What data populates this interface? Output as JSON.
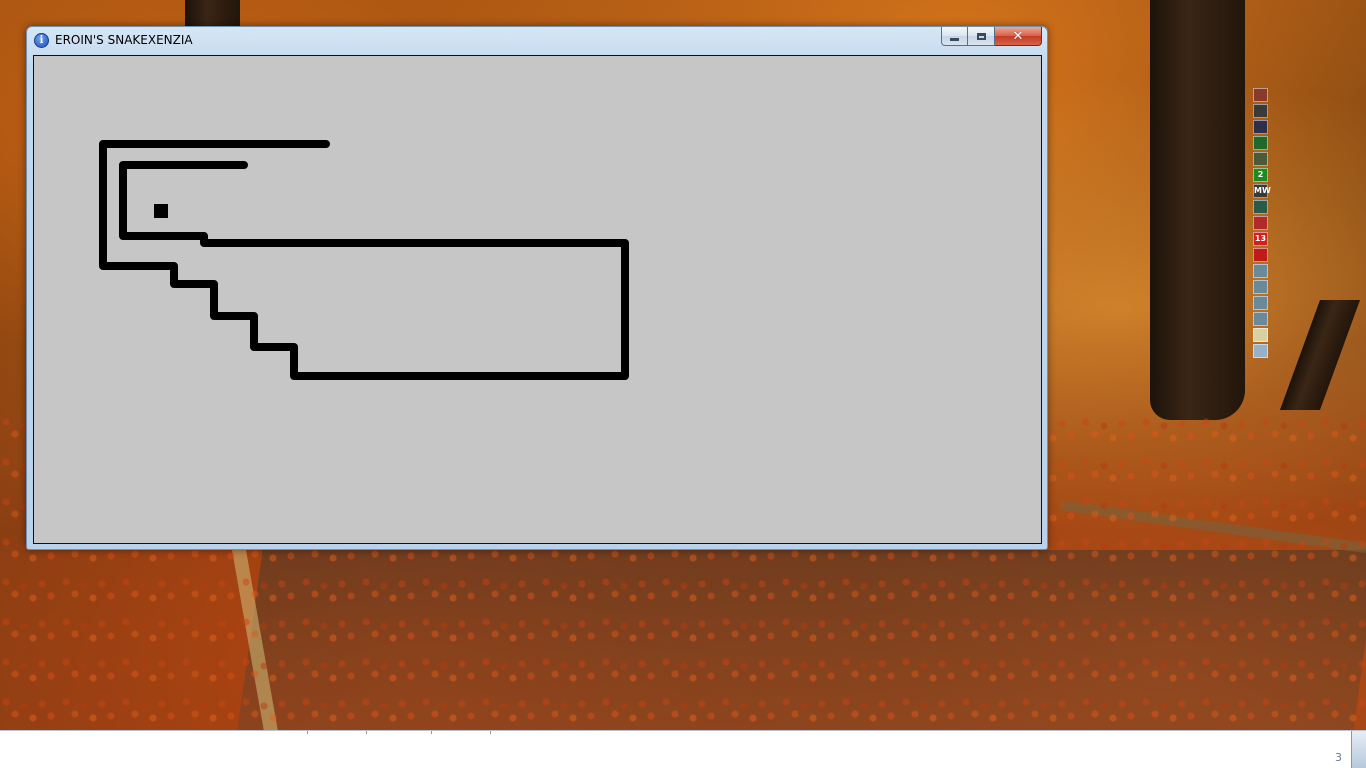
{
  "window": {
    "title": "EROIN'S SNAKEXENZIA",
    "title_icon": "info-icon",
    "controls": {
      "minimize": "minimize-icon",
      "maximize": "maximize-icon",
      "close": "✕"
    }
  },
  "game": {
    "background_color": "#c6c6c6",
    "snake_color": "#000000",
    "food_color": "#000000"
  },
  "desktop": {
    "wallpaper": "autumn-forest-road",
    "strip_icons": [
      {
        "name": "app-icon-1",
        "color": "#8a3a2a",
        "label": ""
      },
      {
        "name": "app-icon-2",
        "color": "#3a3a3a",
        "label": ""
      },
      {
        "name": "app-icon-3",
        "color": "#2f2f4a",
        "label": ""
      },
      {
        "name": "app-icon-4",
        "color": "#1f6a2a",
        "label": ""
      },
      {
        "name": "app-icon-5",
        "color": "#4a5a3a",
        "label": ""
      },
      {
        "name": "app-icon-6",
        "color": "#1f8a1f",
        "label": "2"
      },
      {
        "name": "app-icon-7",
        "color": "#3a3a3a",
        "label": "MW"
      },
      {
        "name": "app-icon-8",
        "color": "#2a5a4a",
        "label": ""
      },
      {
        "name": "app-icon-9",
        "color": "#b02a2a",
        "label": ""
      },
      {
        "name": "app-icon-10",
        "color": "#d02020",
        "label": "13"
      },
      {
        "name": "app-icon-11",
        "color": "#c01a1a",
        "label": ""
      },
      {
        "name": "app-icon-12",
        "color": "#6a8a9a",
        "label": ""
      },
      {
        "name": "app-icon-13",
        "color": "#6a8a9a",
        "label": ""
      },
      {
        "name": "app-icon-14",
        "color": "#6a8a9a",
        "label": ""
      },
      {
        "name": "app-icon-15",
        "color": "#6a8a9a",
        "label": ""
      },
      {
        "name": "app-icon-16",
        "color": "#d8d0a0",
        "label": ""
      },
      {
        "name": "recycle-bin-icon",
        "color": "#9ab0c8",
        "label": ""
      }
    ]
  },
  "taskbar": {
    "clock_fragment": "3"
  }
}
